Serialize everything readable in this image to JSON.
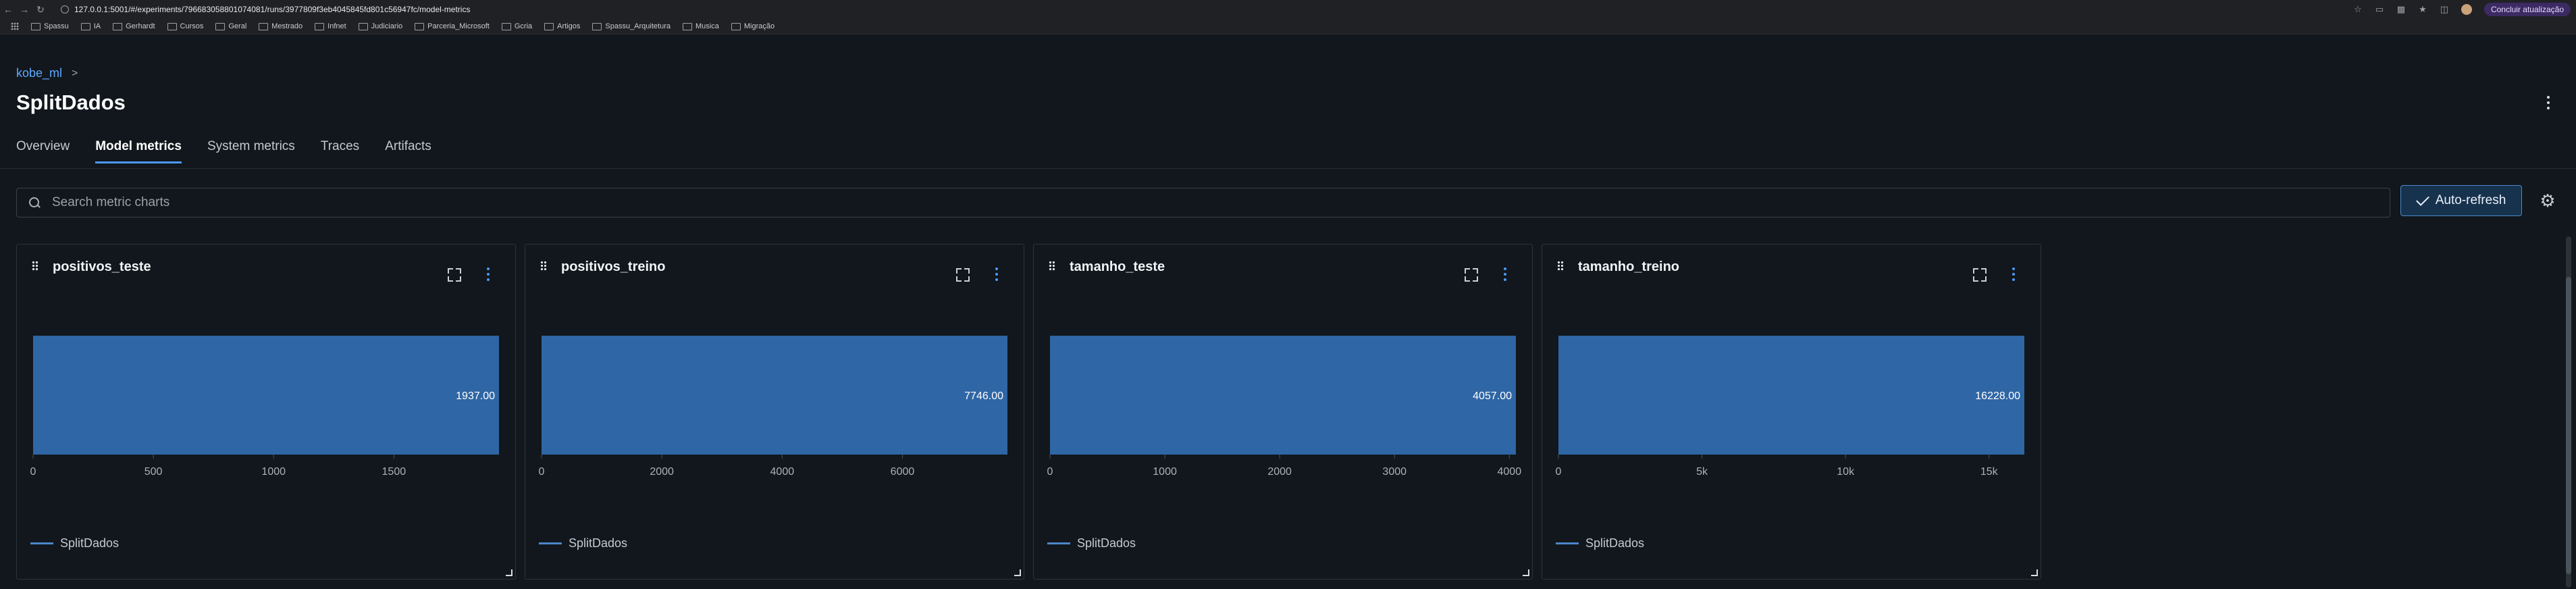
{
  "browser": {
    "url": "127.0.0.1:5001/#/experiments/796683058801074081/runs/3977809f3eb4045845fd801c56947fc/model-metrics",
    "update_label": "Concluir atualização",
    "bookmarks": [
      "Spassu",
      "IA",
      "Gerhardt",
      "Cursos",
      "Geral",
      "Mestrado",
      "Infnet",
      "Judiciario",
      "Parceria_Microsoft",
      "Gcria",
      "Artigos",
      "Spassu_Arquitetura",
      "Musica",
      "Migração"
    ]
  },
  "breadcrumb": {
    "experiment": "kobe_ml",
    "separator": ">"
  },
  "page": {
    "title": "SplitDados"
  },
  "tabs": [
    {
      "label": "Overview"
    },
    {
      "label": "Model metrics"
    },
    {
      "label": "System metrics"
    },
    {
      "label": "Traces"
    },
    {
      "label": "Artifacts"
    }
  ],
  "search": {
    "placeholder": "Search metric charts"
  },
  "toolbar": {
    "autorefresh_label": "Auto-refresh"
  },
  "colors": {
    "bar": "#2f66a5",
    "accent": "#4c9aff",
    "background": "#11171c"
  },
  "cards": [
    {
      "title": "positivos_teste",
      "legend": "SplitDados"
    },
    {
      "title": "positivos_treino",
      "legend": "SplitDados"
    },
    {
      "title": "tamanho_teste",
      "legend": "SplitDados"
    },
    {
      "title": "tamanho_treino",
      "legend": "SplitDados"
    }
  ],
  "chart_data": [
    {
      "type": "bar",
      "orientation": "horizontal",
      "title": "positivos_teste",
      "categories": [
        "SplitDados"
      ],
      "values": [
        1937.0
      ],
      "value_label": "1937.00",
      "xlim": [
        0,
        1937
      ],
      "ticks": [
        0,
        500,
        1000,
        1500
      ],
      "tick_labels": [
        "0",
        "500",
        "1000",
        "1500"
      ],
      "legend": [
        "SplitDados"
      ]
    },
    {
      "type": "bar",
      "orientation": "horizontal",
      "title": "positivos_treino",
      "categories": [
        "SplitDados"
      ],
      "values": [
        7746.0
      ],
      "value_label": "7746.00",
      "xlim": [
        0,
        7746
      ],
      "ticks": [
        0,
        2000,
        4000,
        6000
      ],
      "tick_labels": [
        "0",
        "2000",
        "4000",
        "6000"
      ],
      "legend": [
        "SplitDados"
      ]
    },
    {
      "type": "bar",
      "orientation": "horizontal",
      "title": "tamanho_teste",
      "categories": [
        "SplitDados"
      ],
      "values": [
        4057.0
      ],
      "value_label": "4057.00",
      "xlim": [
        0,
        4057
      ],
      "ticks": [
        0,
        1000,
        2000,
        3000,
        4000
      ],
      "tick_labels": [
        "0",
        "1000",
        "2000",
        "3000",
        "4000"
      ],
      "legend": [
        "SplitDados"
      ]
    },
    {
      "type": "bar",
      "orientation": "horizontal",
      "title": "tamanho_treino",
      "categories": [
        "SplitDados"
      ],
      "values": [
        16228.0
      ],
      "value_label": "16228.00",
      "xlim": [
        0,
        16228
      ],
      "ticks": [
        0,
        5000,
        10000,
        15000
      ],
      "tick_labels": [
        "0",
        "5k",
        "10k",
        "15k"
      ],
      "legend": [
        "SplitDados"
      ]
    }
  ]
}
